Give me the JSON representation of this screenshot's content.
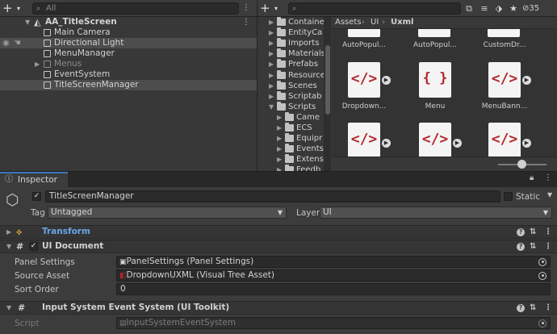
{
  "hierarchy": {
    "search_placeholder": "All",
    "scene": "AA_TitleScreen",
    "items": [
      {
        "label": "Main Camera"
      },
      {
        "label": "Directional Light"
      },
      {
        "label": "MenuManager"
      },
      {
        "label": "Menus"
      },
      {
        "label": "EventSystem"
      },
      {
        "label": "TitleScreenManager"
      }
    ]
  },
  "project": {
    "folders": [
      "Containe",
      "EntityCa",
      "Imports",
      "Materials",
      "Prefabs",
      "Resource",
      "Scenes",
      "Scriptab",
      "Scripts",
      "Came",
      "ECS",
      "Equipr",
      "Events",
      "Extens",
      "Feedb"
    ],
    "breadcrumb": {
      "root": "Assets",
      "sep1": "›",
      "mid": "UI",
      "sep2": "›",
      "current": "Uxml"
    },
    "top_partial": [
      "AutoPopul...",
      "AutoPopul...",
      "CustomDr..."
    ],
    "assets": [
      {
        "name": "Dropdown...",
        "code": "</>"
      },
      {
        "name": "Menu",
        "code": "{ }"
      },
      {
        "name": "MenuBann...",
        "code": "</>"
      },
      {
        "name": "",
        "code": "</>"
      },
      {
        "name": "",
        "code": "</>"
      },
      {
        "name": "",
        "code": "</>"
      }
    ],
    "hidden_count": "35"
  },
  "inspector": {
    "tab_label": "Inspector",
    "object_name": "TitleScreenManager",
    "static_label": "Static",
    "tag_label": "Tag",
    "tag_value": "Untagged",
    "layer_label": "Layer",
    "layer_value": "UI",
    "components": {
      "transform": {
        "title": "Transform"
      },
      "ui_document": {
        "title": "UI Document",
        "panel_settings_label": "Panel Settings",
        "panel_settings_value": "PanelSettings (Panel Settings)",
        "source_asset_label": "Source Asset",
        "source_asset_value": "DropdownUXML (Visual Tree Asset)",
        "sort_order_label": "Sort Order",
        "sort_order_value": "0"
      },
      "input_system": {
        "title": "Input System Event System (UI Toolkit)",
        "script_label": "Script",
        "script_value": "InputSystemEventSystem"
      }
    }
  },
  "colors": {
    "accent": "#3a79bb",
    "code_red": "#b3262b",
    "transform_blue": "#6aa6e8"
  },
  "icons": [
    "plus-icon",
    "search-icon",
    "scene-icon",
    "gameobject-icon",
    "eye-icon",
    "hand-icon",
    "folder-icon",
    "uxml-icon",
    "uss-icon",
    "play-icon",
    "lock-icon",
    "menu-icon",
    "help-icon",
    "settings-icon",
    "kebab-icon",
    "object-picker-icon"
  ]
}
